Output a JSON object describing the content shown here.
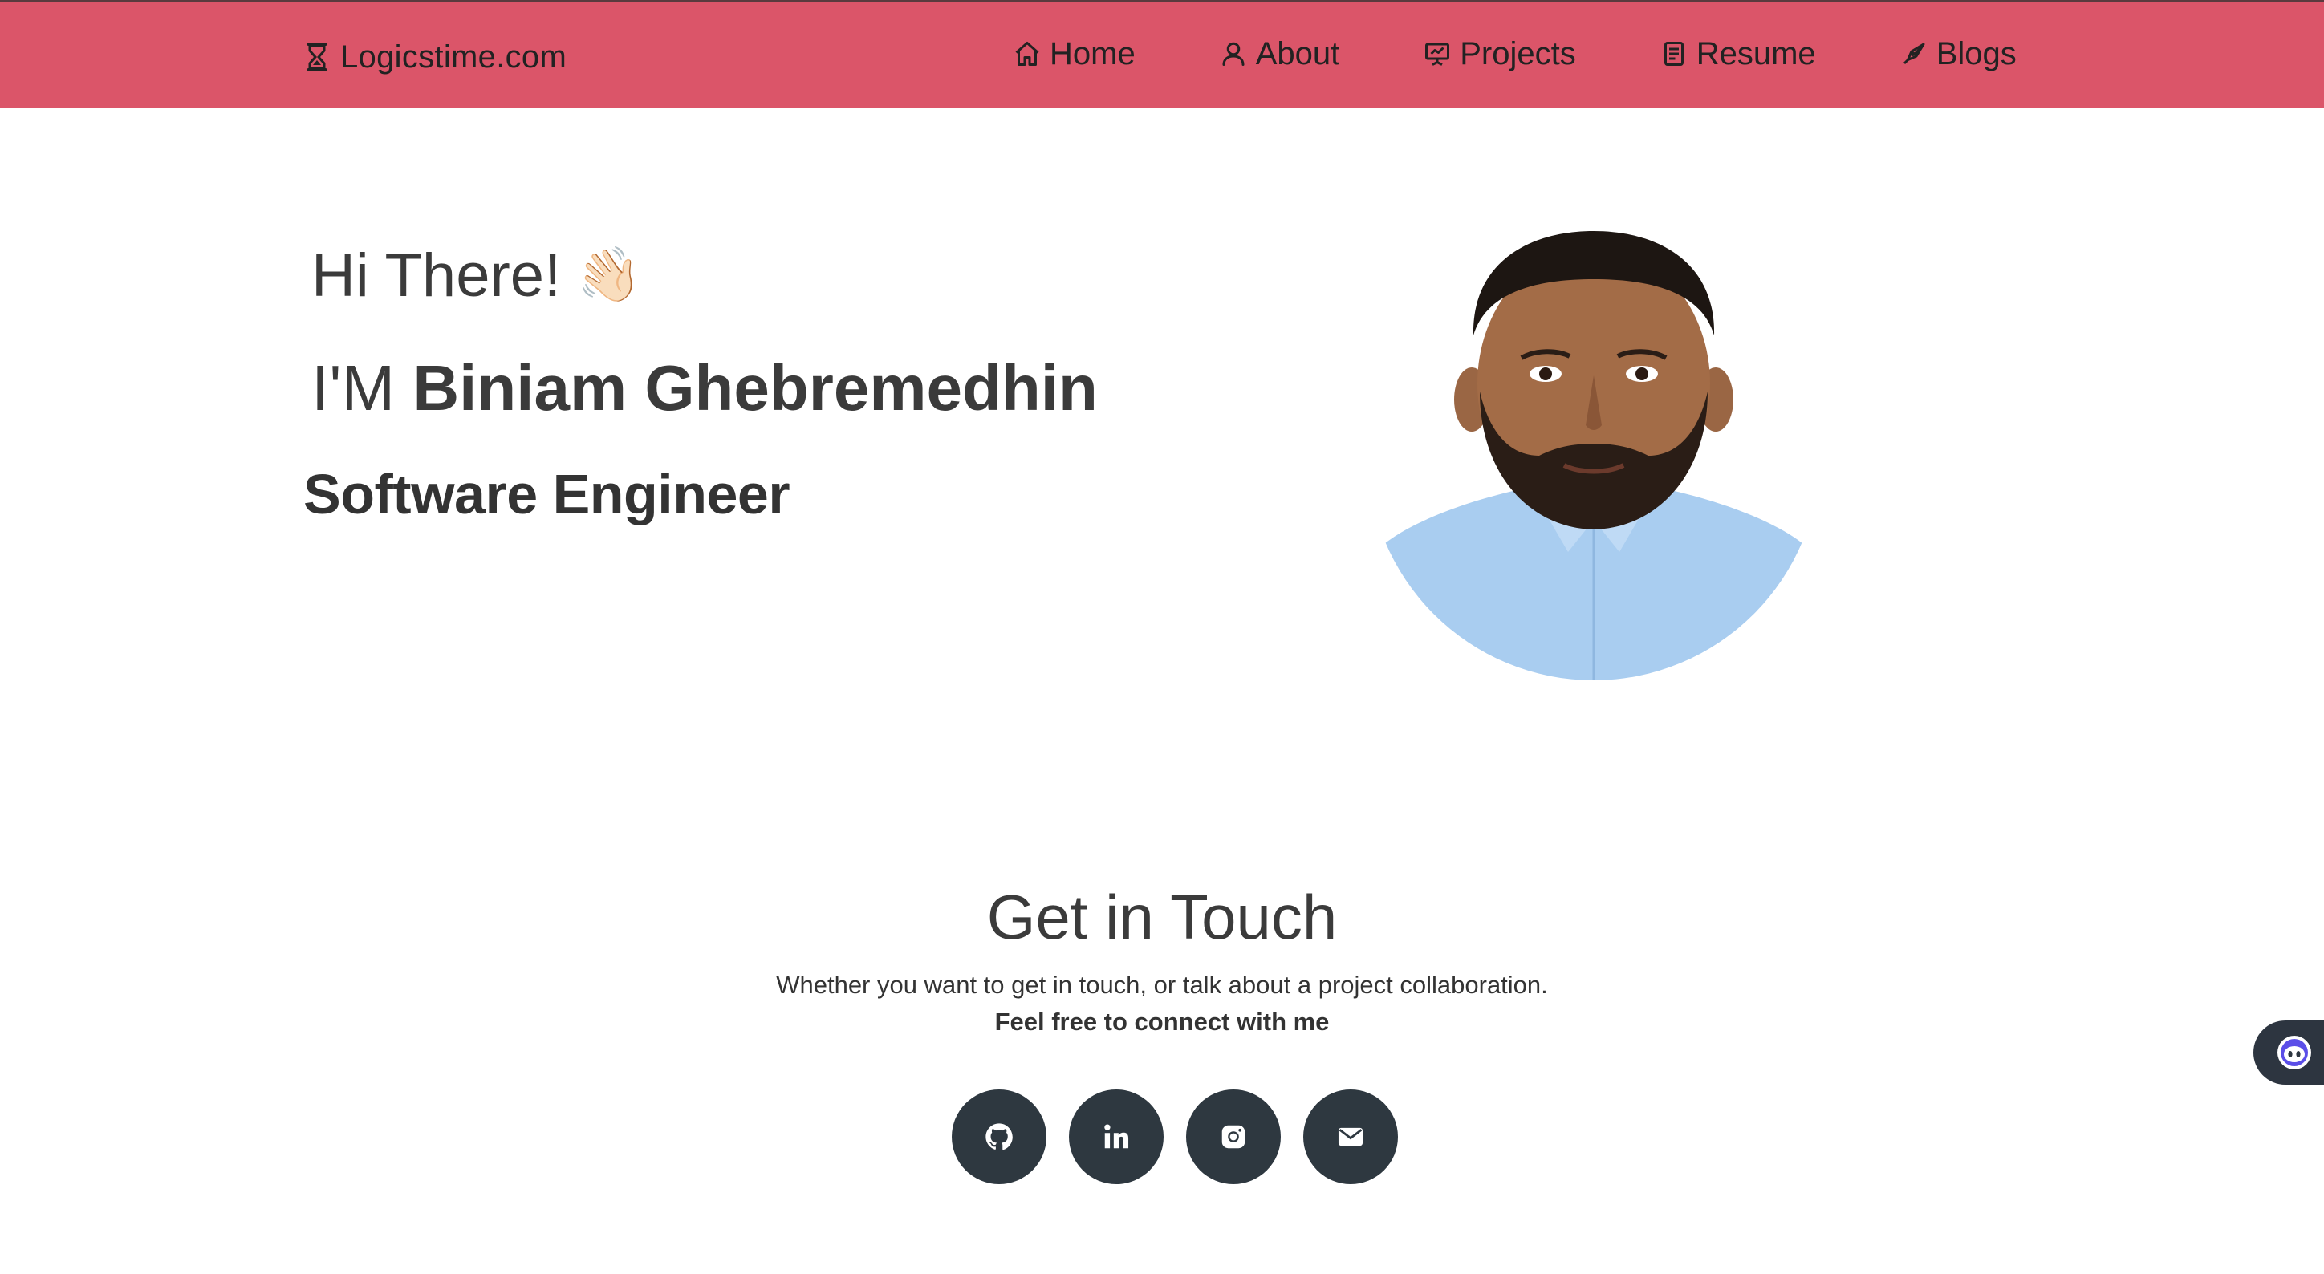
{
  "brand": {
    "name": "Logicstime.com",
    "icon": "hourglass-icon"
  },
  "nav": {
    "items": [
      {
        "label": "Home",
        "icon": "home-icon"
      },
      {
        "label": "About",
        "icon": "user-icon"
      },
      {
        "label": "Projects",
        "icon": "presentation-icon"
      },
      {
        "label": "Resume",
        "icon": "document-icon"
      },
      {
        "label": "Blogs",
        "icon": "pen-nib-icon"
      }
    ]
  },
  "hero": {
    "greeting": "Hi There!",
    "wave_emoji": "👋🏻",
    "name_prefix": "I'M",
    "name": "Biniam Ghebremedhin",
    "role": "Software Engineer"
  },
  "contact": {
    "title": "Get in Touch",
    "subtitle": "Whether you want to get in touch, or talk about a project collaboration.",
    "cta": "Feel free to connect with me",
    "socials": [
      {
        "icon": "github-icon"
      },
      {
        "icon": "linkedin-icon"
      },
      {
        "icon": "instagram-icon"
      },
      {
        "icon": "mail-icon"
      }
    ]
  },
  "colors": {
    "navbar": "#db5569",
    "social_button": "#2e3840",
    "text": "#3b3b3b"
  }
}
